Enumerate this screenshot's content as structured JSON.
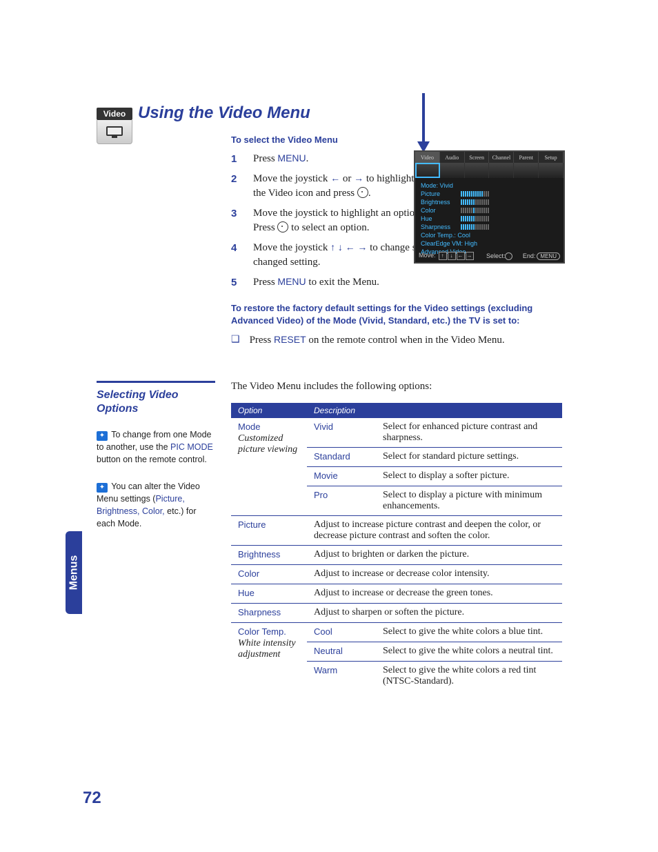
{
  "tab_label": "Menus",
  "icon_label": "Video",
  "title": "Using the Video Menu",
  "sub1": "To select the Video Menu",
  "steps": {
    "s1a": "Press ",
    "s1b": "MENU",
    "s1c": ".",
    "s2a": "Move the joystick ",
    "s2b": " or ",
    "s2c": " to highlight the Video icon and press ",
    "s3a": "Move the joystick to highlight an option. Press ",
    "s3b": " to select an option.",
    "s4a": "Move the joystick ",
    "s4b": " to change settings. Press ",
    "s4c": " to select the changed setting.",
    "s5a": "Press ",
    "s5b": "MENU",
    "s5c": " to exit the Menu."
  },
  "sub2": "To restore the factory default settings for the Video settings (excluding Advanced Video) of the Mode (Vivid, Standard, etc.) the TV is set to:",
  "restore_a": "Press ",
  "restore_b": "RESET",
  "restore_c": " on the remote control when in the Video Menu.",
  "section_head": "Selecting Video Options",
  "tip1_a": " To change from one Mode to another, use the ",
  "tip1_b": "PIC MODE",
  "tip1_c": " button on the remote control.",
  "tip2_a": " You can alter the Video Menu settings (",
  "tip2_b": "Picture, Brightness, Color,",
  "tip2_c": " etc.) for each Mode.",
  "intro": "The Video Menu includes the following options:",
  "th_option": "Option",
  "th_desc": "Description",
  "rows": {
    "mode_opt": "Mode",
    "mode_sub": "Customized picture viewing",
    "vivid": "Vivid",
    "vivid_d": "Select for enhanced picture contrast and sharpness.",
    "standard": "Standard",
    "standard_d": "Select for standard picture settings.",
    "movie": "Movie",
    "movie_d": "Select to display a softer picture.",
    "pro": "Pro",
    "pro_d": "Select to display a picture with minimum enhancements.",
    "picture": "Picture",
    "picture_d": "Adjust to increase picture contrast and deepen the color, or decrease picture contrast and soften the color.",
    "brightness": "Brightness",
    "brightness_d": "Adjust to brighten or darken the picture.",
    "color": "Color",
    "color_d": "Adjust to increase or decrease color intensity.",
    "hue": "Hue",
    "hue_d": "Adjust to increase or decrease the green tones.",
    "sharpness": "Sharpness",
    "sharpness_d": "Adjust to sharpen or soften the picture.",
    "ct": "Color Temp.",
    "ct_sub": "White intensity adjustment",
    "cool": "Cool",
    "cool_d": "Select to give the white colors a blue tint.",
    "neutral": "Neutral",
    "neutral_d": "Select to give the white colors a neutral tint.",
    "warm": "Warm",
    "warm_d": "Select to give the white colors a red tint (NTSC-Standard)."
  },
  "osd": {
    "tabs": [
      "Video",
      "Audio",
      "Screen",
      "Channel",
      "Parent",
      "Setup"
    ],
    "mode_line": "Mode: Vivid",
    "items": [
      "Picture",
      "Brightness",
      "Color",
      "Hue",
      "Sharpness"
    ],
    "ct": "Color Temp.: Cool",
    "vm": "ClearEdge VM: High",
    "adv": "Advanced Video",
    "move": "Move:",
    "select": "Select:",
    "end": "End:",
    "menu": "MENU"
  },
  "page_number": "72"
}
